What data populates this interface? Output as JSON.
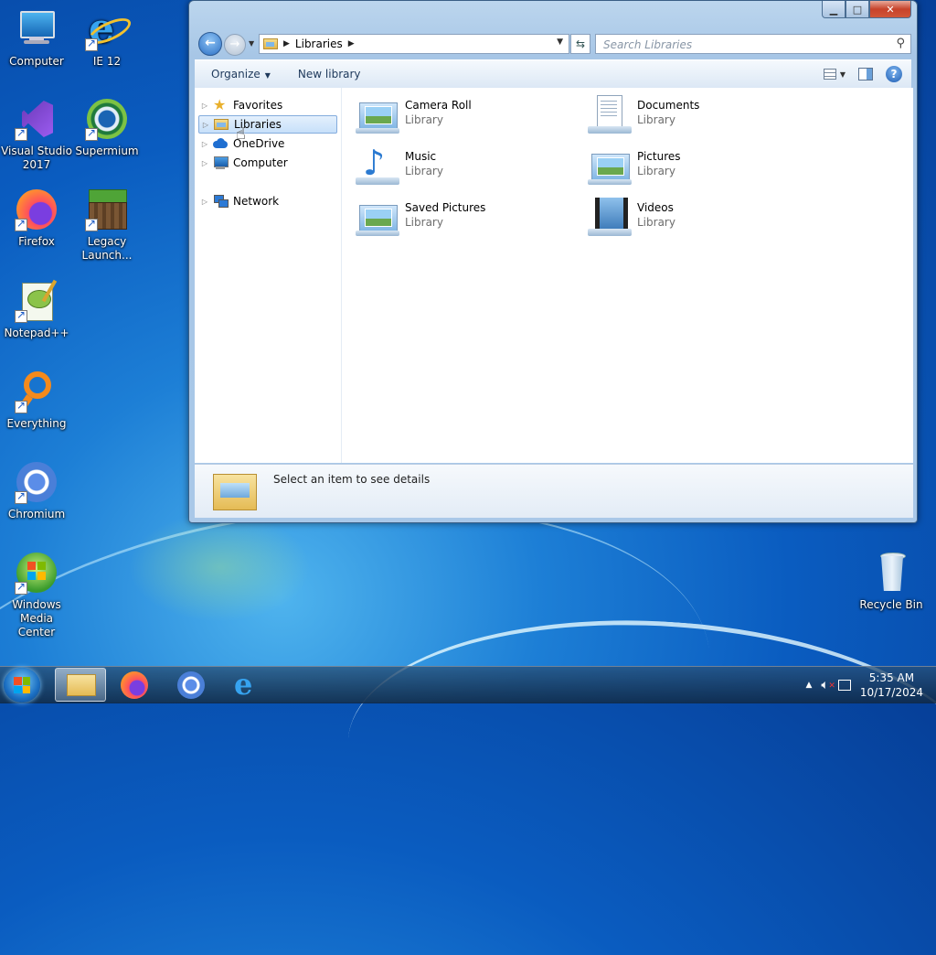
{
  "desktop": {
    "icons": [
      {
        "label": "Computer"
      },
      {
        "label": "IE 12"
      },
      {
        "label": "Visual Studio 2017"
      },
      {
        "label": "Supermium"
      },
      {
        "label": "Firefox"
      },
      {
        "label": "Legacy Launch..."
      },
      {
        "label": "Notepad++"
      },
      {
        "label": "Everything"
      },
      {
        "label": "Chromium"
      },
      {
        "label": "Windows Media Center"
      },
      {
        "label": "Recycle Bin"
      }
    ]
  },
  "window": {
    "address": {
      "crumb": "Libraries"
    },
    "search": {
      "placeholder": "Search Libraries"
    },
    "toolbar": {
      "organize": "Organize",
      "new_library": "New library"
    },
    "nav": {
      "items": [
        {
          "label": "Favorites"
        },
        {
          "label": "Libraries"
        },
        {
          "label": "OneDrive"
        },
        {
          "label": "Computer"
        },
        {
          "label": "Network"
        }
      ]
    },
    "libraries": [
      {
        "name": "Camera Roll",
        "type": "Library"
      },
      {
        "name": "Documents",
        "type": "Library"
      },
      {
        "name": "Music",
        "type": "Library"
      },
      {
        "name": "Pictures",
        "type": "Library"
      },
      {
        "name": "Saved Pictures",
        "type": "Library"
      },
      {
        "name": "Videos",
        "type": "Library"
      }
    ],
    "details": {
      "text": "Select an item to see details"
    }
  },
  "taskbar": {
    "time": "5:35 AM",
    "date": "10/17/2024"
  },
  "colors": {
    "accent": "#1f5db3",
    "selection": "#c7e0fa"
  }
}
